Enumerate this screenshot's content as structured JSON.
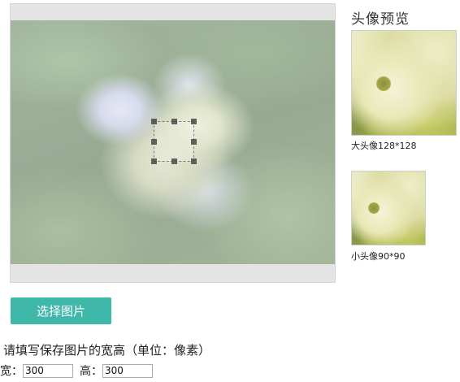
{
  "cropper": {
    "photo_subject": "hydrangea-flower-photo"
  },
  "preview": {
    "title": "头像预览",
    "large_caption": "大头像128*128",
    "small_caption": "小头像90*90"
  },
  "actions": {
    "select_image_label": "选择图片"
  },
  "size_form": {
    "hint": "请填写保存图片的宽高（单位：像素）",
    "width_label": "宽：",
    "width_value": "300",
    "height_label": "高：",
    "height_value": "300"
  },
  "colors": {
    "accent": "#3fb8a9"
  }
}
